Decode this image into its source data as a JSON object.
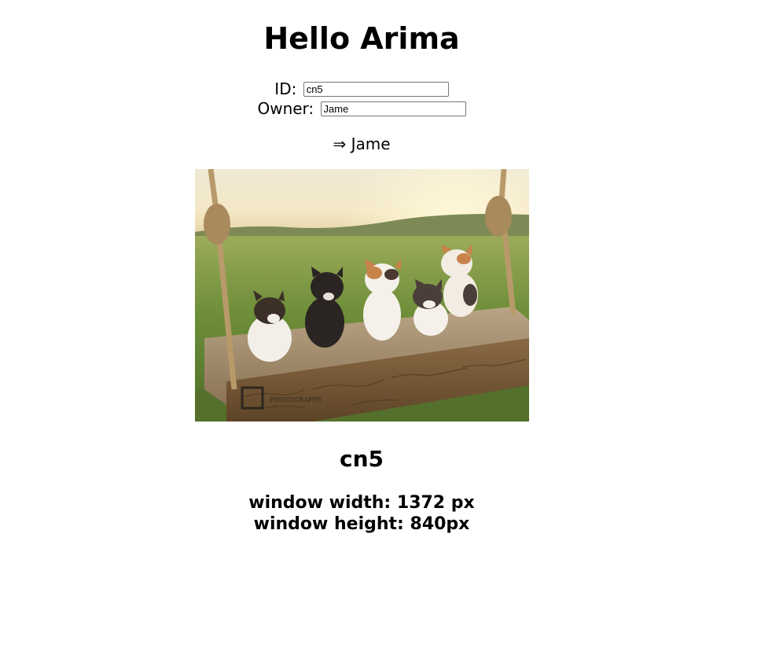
{
  "greeting": "Hello Arima",
  "form": {
    "id_label": "ID:",
    "id_value": "cn5",
    "owner_label": "Owner:",
    "owner_value": "Jame"
  },
  "owner_display": "⇒ Jame",
  "photo": {
    "alt": "Five kittens sitting on a wooden swing in a grassy field",
    "watermark": "PHOTOGRAPHY"
  },
  "id_heading": "cn5",
  "window": {
    "width_text": "window width: 1372 px",
    "height_text": "window height: 840px"
  }
}
